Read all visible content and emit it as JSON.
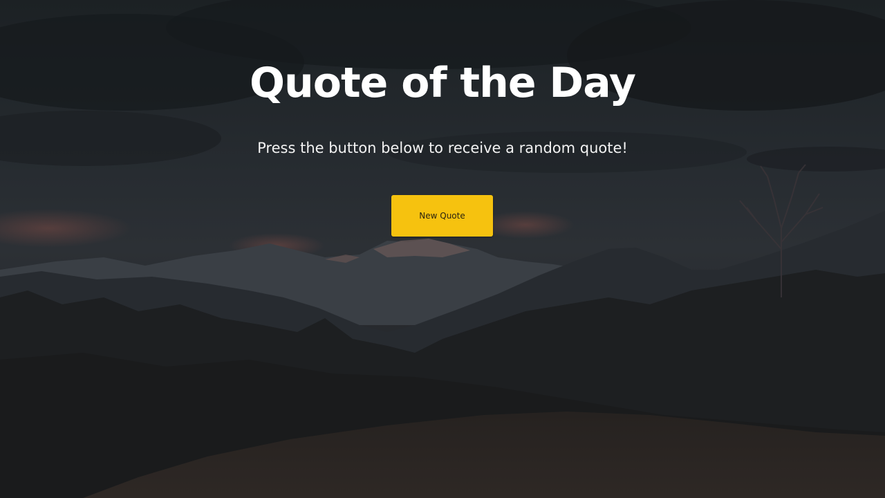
{
  "page": {
    "title": "Quote of the Day",
    "subtitle": "Press the button below to receive a random quote!",
    "button_label": "New Quote"
  },
  "colors": {
    "button": "#f6c20f",
    "title": "#ffffff",
    "background_overlay": "#1a1c1f"
  },
  "background": {
    "icon": "mountain-dusk-scene"
  }
}
